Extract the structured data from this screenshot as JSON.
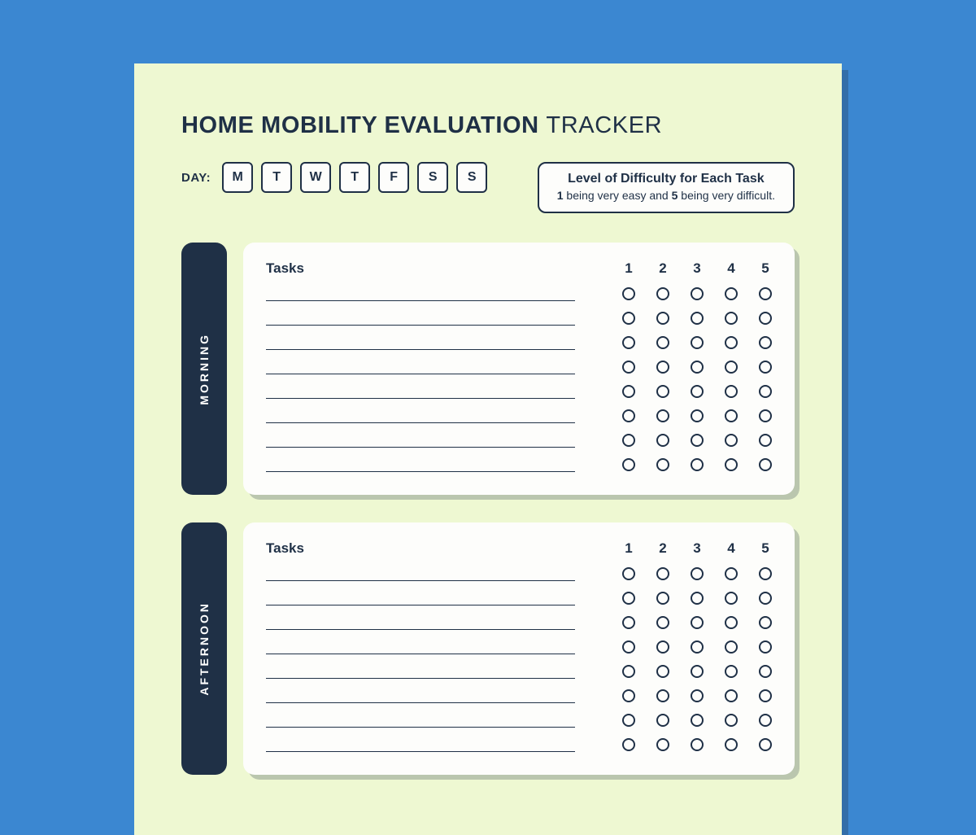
{
  "title": {
    "bold": "HOME MOBILITY EVALUATION",
    "light": "TRACKER"
  },
  "day": {
    "label": "DAY:",
    "options": [
      "M",
      "T",
      "W",
      "T",
      "F",
      "S",
      "S"
    ]
  },
  "legend": {
    "title": "Level of Difficulty for Each Task",
    "sub_prefix": "1",
    "sub_mid1": " being very easy and ",
    "sub_bold2": "5",
    "sub_mid2": " being very difficult."
  },
  "rating_labels": [
    "1",
    "2",
    "3",
    "4",
    "5"
  ],
  "sections": [
    {
      "label": "MORNING",
      "tasks_heading": "Tasks",
      "rows": 8
    },
    {
      "label": "AFTERNOON",
      "tasks_heading": "Tasks",
      "rows": 8
    }
  ]
}
